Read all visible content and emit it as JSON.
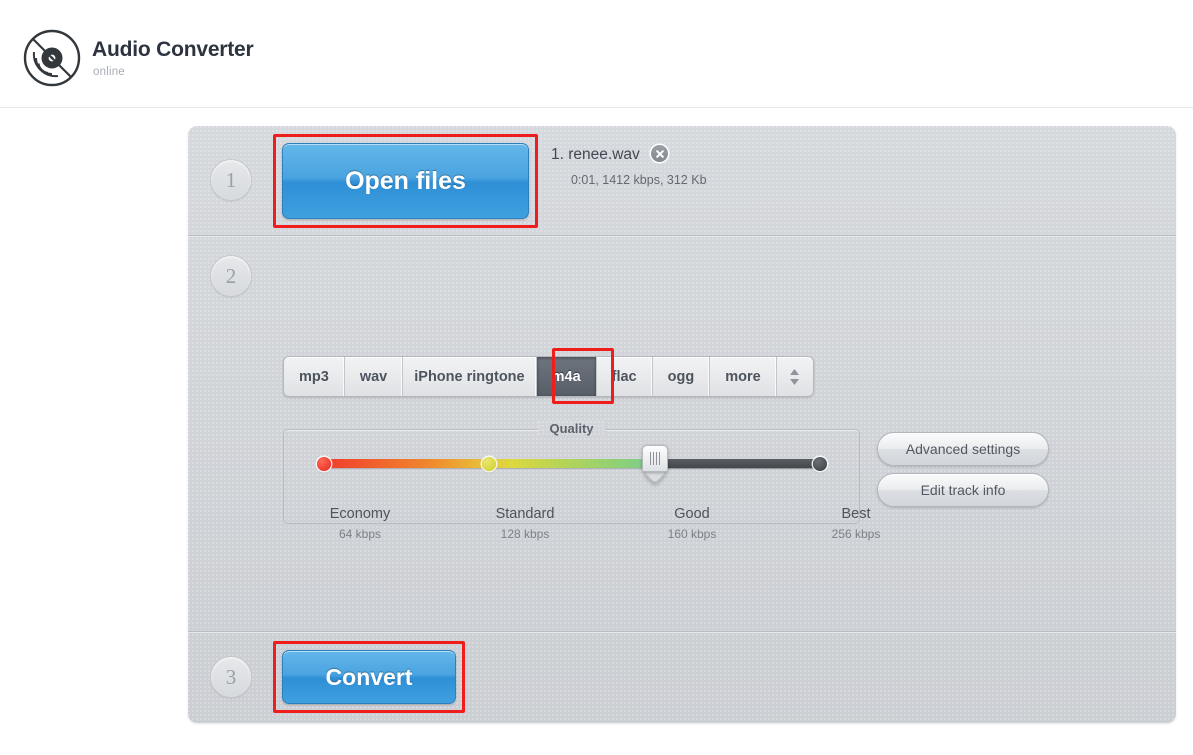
{
  "header": {
    "logo_icon": "vinyl-record-icon",
    "title": "Audio Converter",
    "subtitle": "online"
  },
  "steps": [
    {
      "number": "1"
    },
    {
      "number": "2"
    },
    {
      "number": "3"
    }
  ],
  "step1": {
    "open_files_label": "Open files",
    "file": {
      "index": "1.",
      "name": "renee.wav",
      "meta": "0:01, 1412 kbps, 312 Kb",
      "remove_icon": "close-circle-icon"
    }
  },
  "step2": {
    "formats": [
      {
        "label": "mp3",
        "selected": false
      },
      {
        "label": "wav",
        "selected": false
      },
      {
        "label": "iPhone ringtone",
        "selected": false
      },
      {
        "label": "m4a",
        "selected": true
      },
      {
        "label": "flac",
        "selected": false
      },
      {
        "label": "ogg",
        "selected": false
      },
      {
        "label": "more",
        "selected": false
      }
    ],
    "stepper_icon": "up-down-arrows-icon",
    "quality": {
      "legend": "Quality",
      "selected_level": "Good",
      "selected_bitrate": "160 kbps",
      "ticks": [
        {
          "name": "Economy",
          "bitrate": "64 kbps"
        },
        {
          "name": "Standard",
          "bitrate": "128 kbps"
        },
        {
          "name": "Good",
          "bitrate": "160 kbps"
        },
        {
          "name": "Best",
          "bitrate": "256 kbps"
        }
      ]
    },
    "advanced_settings_label": "Advanced settings",
    "edit_track_info_label": "Edit track info"
  },
  "step3": {
    "convert_label": "Convert"
  },
  "colors": {
    "accent_blue": "#3f9fdd",
    "annotation_red": "#f01d1d",
    "panel_gray": "#d2d5da",
    "selected_tab": "#5f666f"
  }
}
